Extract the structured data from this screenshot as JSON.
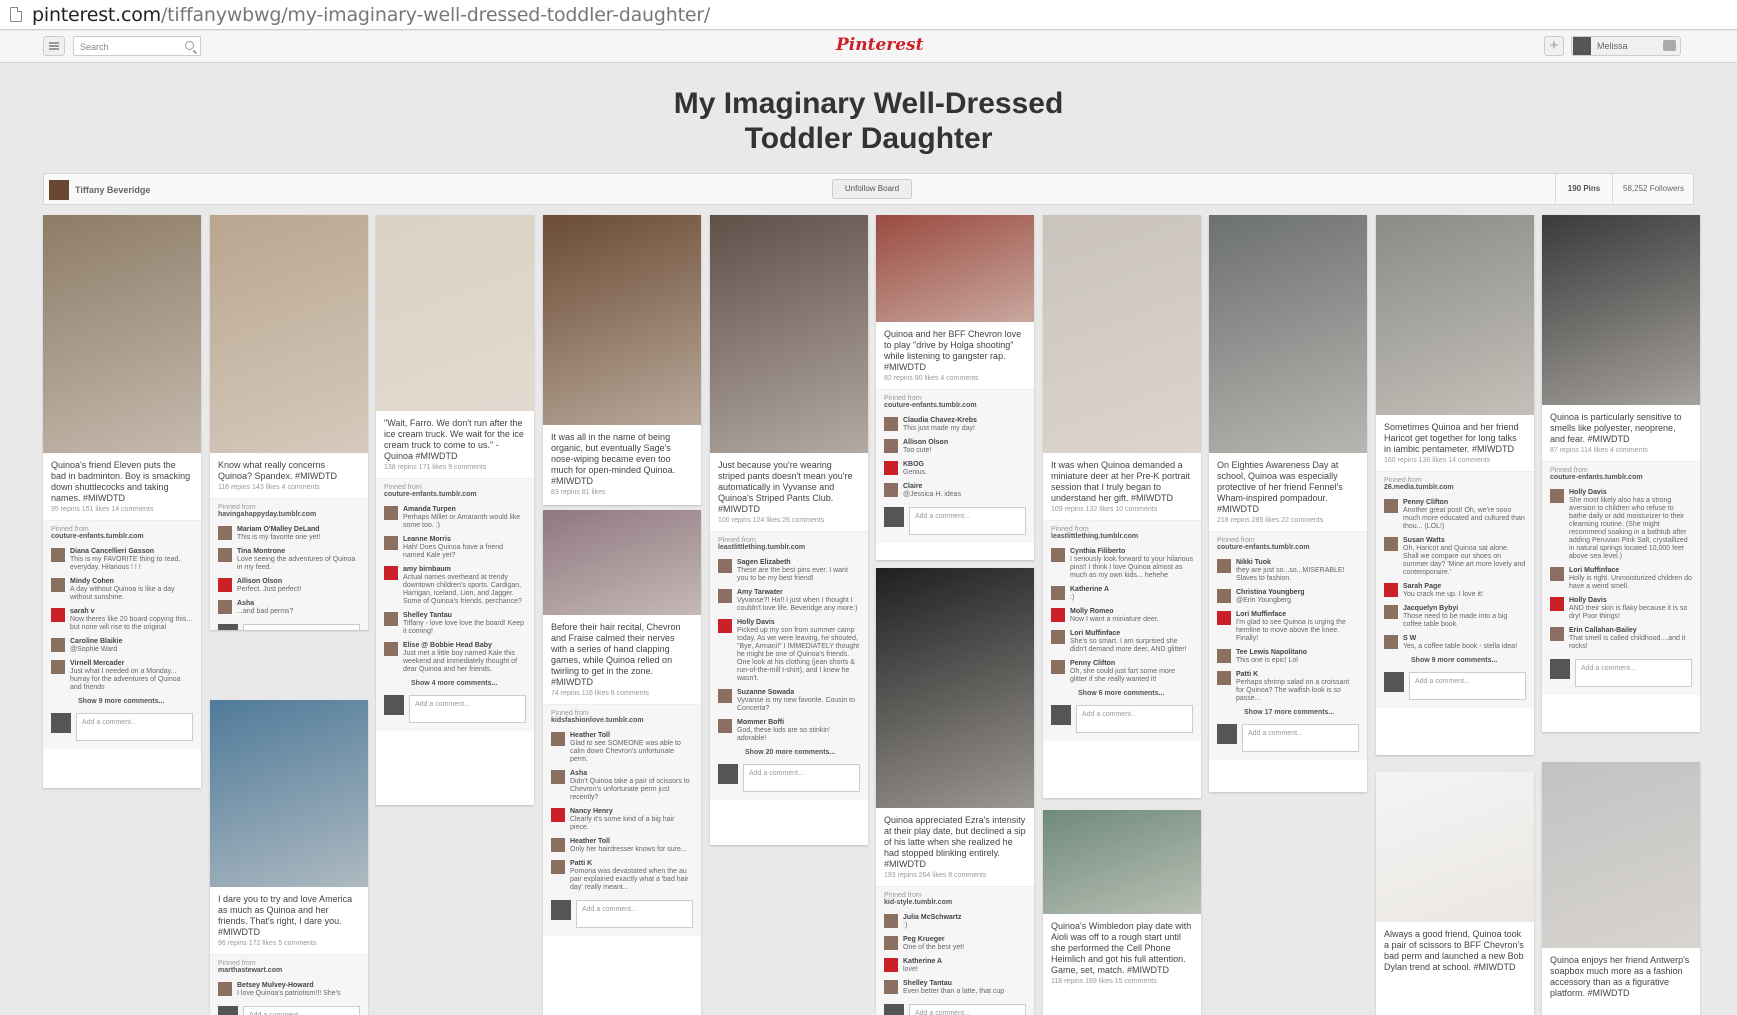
{
  "browser": {
    "url_domain": "pinterest.com",
    "url_path": "/tiffanywbwg/my-imaginary-well-dressed-toddler-daughter/"
  },
  "header": {
    "search_placeholder": "Search",
    "logo": "Pinterest",
    "user_name": "Melissa",
    "add_label": "+"
  },
  "board": {
    "title_line1": "My Imaginary Well-Dressed",
    "title_line2": "Toddler Daughter",
    "owner": "Tiffany Beveridge",
    "unfollow_label": "Unfollow Board",
    "pins_count": "190 Pins",
    "followers_count": "58,252 Followers"
  },
  "add_comment_placeholder": "Add a comment...",
  "pins": [
    {
      "desc": "Quinoa's friend Eleven puts the bad in badminton. Boy is smacking down shuttlecocks and taking names. #MIWDTD",
      "stats": "95 repins   151 likes   14 comments",
      "source": "couture-enfants.tumblr.com",
      "comments": [
        {
          "name": "Diana Cancellieri Gasson",
          "text": "This is my FAVORITE thing to read, everyday. Hilarious ! ! !"
        },
        {
          "name": "Mindy Cohen",
          "text": "A day without Quinoa is like a day without sunshine."
        },
        {
          "name": "sarah v",
          "text": "Now theres like 20 board copying this... but none will rise to the original"
        },
        {
          "name": "Caroline Blaikie",
          "text": "@Sophie Ward"
        },
        {
          "name": "Virnell Mercader",
          "text": "Just what I needed on a Monday... hurray for the adventures of Quinoa and friends"
        }
      ],
      "more": "Show 9 more comments..."
    },
    {
      "desc": "Know what really concerns Quinoa? Spandex. #MIWDTD",
      "stats": "116 repins   143 likes   4 comments",
      "source": "havingahappyday.tumblr.com",
      "comments": [
        {
          "name": "Mariam O'Malley DeLand",
          "text": "This is my favorite one yet!"
        },
        {
          "name": "Tina Montrone",
          "text": "Love seeing the adventures of Quinoa in my feed."
        },
        {
          "name": "Allison Olson",
          "text": "Perfect. Just perfect!"
        },
        {
          "name": "Asha",
          "text": "...and bad perms?"
        }
      ],
      "more": ""
    },
    {
      "desc": "\"Wait, Farro. We don't run after the ice cream truck. We wait for the ice cream truck to come to us.\" - Quinoa #MIWDTD",
      "stats": "138 repins   171 likes   9 comments",
      "source": "couture-enfants.tumblr.com",
      "comments": [
        {
          "name": "Amanda Turpen",
          "text": "Perhaps Millet or Amaranth would like some too. :)"
        },
        {
          "name": "Leanne Morris",
          "text": "Hah! Does Quinoa have a friend named Kale yet?"
        },
        {
          "name": "amy birnbaum",
          "text": "Actual names overheard at trendy downtown children's sports. Cardigan, Harrigan, Iceland, Lion, and Jagger. Some of Quinoa's friends, perchance?"
        },
        {
          "name": "Shelley Tantau",
          "text": "Tiffany - love love love the board! Keep it coming!"
        },
        {
          "name": "Elise @ Bobbie Head Baby",
          "text": "Just met a little boy named Kale this weekend and immediately thought of dear Quinoa and her friends."
        }
      ],
      "more": "Show 4 more comments..."
    },
    {
      "desc": "It was all in the name of being organic, but eventually Sage's nose-wiping became even too much for open-minded Quinoa. #MIWDTD",
      "stats": "83 repins   81 likes",
      "source": "",
      "comments": [],
      "more": ""
    },
    {
      "desc": "Before their hair recital, Chevron and Fraise calmed their nerves with a series of hand clapping games, while Quinoa relied on twirling to get in the zone. #MIWDTD",
      "stats": "74 repins   116 likes   6 comments",
      "source": "kidsfashionlove.tumblr.com",
      "comments": [
        {
          "name": "Heather Toll",
          "text": "Glad to see SOMEONE was able to calm down Chevron's unfortunate perm."
        },
        {
          "name": "Asha",
          "text": "Didn't Quinoa take a pair of scissors to Chevron's unfortunate perm just recently?"
        },
        {
          "name": "Nancy Henry",
          "text": "Clearly it's some kind of a big hair piece."
        },
        {
          "name": "Heather Toll",
          "text": "Only her hairdresser knows for sure..."
        },
        {
          "name": "Patti K",
          "text": "Pomona was devastated when the au pair explained exactly what a 'bad hair day' really meant..."
        }
      ],
      "more": ""
    },
    {
      "desc": "Just because you're wearing striped pants doesn't mean you're automatically in Vyvanse and Quinoa's Striped Pants Club. #MIWDTD",
      "stats": "100 repins   124 likes   26 comments",
      "source": "leastlittlething.tumblr.com",
      "comments": [
        {
          "name": "Sagen Elizabeth",
          "text": "These are the best pins ever. I want you to be my best friend!"
        },
        {
          "name": "Amy Tarwater",
          "text": "Vyvanse?! Ha!! I just when I thought I couldn't love life. Beveridge any more:)"
        },
        {
          "name": "Holly Davis",
          "text": "Picked up my son from summer camp today. As we were leaving, he shouted, \"Bye, Armani!\" I IMMEDIATELY thought he might be one of Quinoa's friends. One look at his clothing (jean shorts & run-of-the-mill t-shirt), and I knew he wasn't."
        },
        {
          "name": "Suzanne Sowada",
          "text": "Vyvanse is my new favorite. Cousin to Concerta?"
        },
        {
          "name": "Mommer Boffi",
          "text": "God, these kids are so stinkin' adorable!"
        }
      ],
      "more": "Show 20 more comments..."
    },
    {
      "desc": "Quinoa and her BFF Chevron love to play \"drive by Holga shooting\" while listening to gangster rap. #MIWDTD",
      "stats": "82 repins   90 likes   4 comments",
      "source": "couture-enfants.tumblr.com",
      "comments": [
        {
          "name": "Claudia Chavez-Krebs",
          "text": "This just made my day!"
        },
        {
          "name": "Allison Olson",
          "text": "Too cute!"
        },
        {
          "name": "KBOG",
          "text": "Genius."
        },
        {
          "name": "Claire",
          "text": "@Jessica H. ideas"
        }
      ],
      "more": ""
    },
    {
      "desc": "Quinoa appreciated Ezra's intensity at their play date, but declined a sip of his latte when she realized he had stopped blinking entirely. #MIWDTD",
      "stats": "193 repins   264 likes   8 comments",
      "source": "kid-style.tumblr.com",
      "comments": [
        {
          "name": "Julia McSchwartz",
          "text": ":)"
        },
        {
          "name": "Peg Krueger",
          "text": "One of the best yet!"
        },
        {
          "name": "Katherine A",
          "text": "love!"
        },
        {
          "name": "Shelley Tantau",
          "text": "Even better than a latte, that cup"
        }
      ],
      "more": ""
    },
    {
      "desc": "It was when Quinoa demanded a miniature deer at her Pre-K portrait session that I truly began to understand her gift. #MIWDTD",
      "stats": "109 repins   132 likes   10 comments",
      "source": "leastlittlething.tumblr.com",
      "comments": [
        {
          "name": "Cynthia Filiberto",
          "text": "I seriously look forward to your hilarious pins!! I think I love Quinoa almost as much as my own kids... hehehe"
        },
        {
          "name": "Katherine A",
          "text": ":)"
        },
        {
          "name": "Molly Romeo",
          "text": "Now I want a miniature deer."
        },
        {
          "name": "Lori Muffinface",
          "text": "She's so smart. I am surprised she didn't demand more deer, AND glitter!"
        },
        {
          "name": "Penny Clifton",
          "text": "Oh, she could just fart some more glitter if she really wanted it!"
        }
      ],
      "more": "Show 6 more comments..."
    },
    {
      "desc": "Quinoa's Wimbledon play date with Aioli was off to a rough start until she performed the Cell Phone Heimlich and got his full attention. Game, set, match. #MIWDTD",
      "stats": "118 repins   169 likes   15 comments",
      "source": "",
      "comments": [],
      "more": ""
    },
    {
      "desc": "On Eighties Awareness Day at school, Quinoa was especially protective of her friend Fennel's Wham-inspired pompadour. #MIWDTD",
      "stats": "218 repins   285 likes   22 comments",
      "source": "couture-enfants.tumblr.com",
      "comments": [
        {
          "name": "Nikki Tuok",
          "text": "they are just so...so...MISERABLE! Slaves to fashion."
        },
        {
          "name": "Christina Youngberg",
          "text": "@Erin Youngberg"
        },
        {
          "name": "Lori Muffinface",
          "text": "I'm glad to see Quinoa is urging the hemline to move above the knee. Finally!"
        },
        {
          "name": "Tee Lewis Napolitano",
          "text": "This one is epic! Lol"
        },
        {
          "name": "Patti K",
          "text": "Perhaps shrimp salad on a croissant for Quinoa? The waifish look is so passe..."
        }
      ],
      "more": "Show 17 more comments..."
    },
    {
      "desc": "Sometimes Quinoa and her friend Haricot get together for long talks in iambic pentameter. #MIWDTD",
      "stats": "160 repins   136 likes   14 comments",
      "source": "26.media.tumblr.com",
      "comments": [
        {
          "name": "Penny Clifton",
          "text": "Another great post! Oh, we're sooo much more educated and cultured than thou... (LOL!)"
        },
        {
          "name": "Susan Watts",
          "text": "Oh, Haricot and Quinoa sat alone. Shall we compare our shoes on summer day? 'Mine art more lovely and contemporaire.'"
        },
        {
          "name": "Sarah Page",
          "text": "You crack me up. I love it!"
        },
        {
          "name": "Jacquelyn Bybyi",
          "text": "Those need to be made into a big coffee table book."
        },
        {
          "name": "S W",
          "text": "Yes, a coffee table book - stella idea!"
        }
      ],
      "more": "Show 9 more comments..."
    },
    {
      "desc": "Always a good friend, Quinoa took a pair of scissors to BFF Chevron's bad perm and launched a new Bob Dylan trend at school. #MIWDTD",
      "stats": "",
      "source": "",
      "comments": [],
      "more": ""
    },
    {
      "desc": "Quinoa is particularly sensitive to smells like polyester, neoprene, and fear. #MIWDTD",
      "stats": "87 repins   114 likes   4 comments",
      "source": "couture-enfants.tumblr.com",
      "comments": [
        {
          "name": "Holly Davis",
          "text": "She most likely also has a strong aversion to children who refuse to bathe daily or add moisturizer to their cleansing routine. (She might recommend soaking in a bathtub after adding Peruvian Pink Salt, crystallized in natural springs located 10,000 feet above sea level.)"
        },
        {
          "name": "Lori Muffinface",
          "text": "Holly is right. Unmoisturized children do have a weird smell."
        },
        {
          "name": "Holly Davis",
          "text": "AND their skin is flaky because it is so dry! Poor things!"
        },
        {
          "name": "Erin Callahan-Bailey",
          "text": "That smell is called childhood....and it rocks!"
        }
      ],
      "more": ""
    },
    {
      "desc": "I dare you to try and love America as much as Quinoa and her friends. That's right, I dare you. #MIWDTD",
      "stats": "96 repins   172 likes   5 comments",
      "source": "marthastewart.com",
      "comments": [
        {
          "name": "Betsey Mulvey-Howard",
          "text": "I love Quinoa's patriotism!!! She's"
        }
      ],
      "more": ""
    },
    {
      "desc": "Quinoa enjoys her friend Antwerp's soapbox much more as a fashion accessory than as a figurative platform. #MIWDTD",
      "stats": "",
      "source": "",
      "comments": [],
      "more": ""
    }
  ]
}
